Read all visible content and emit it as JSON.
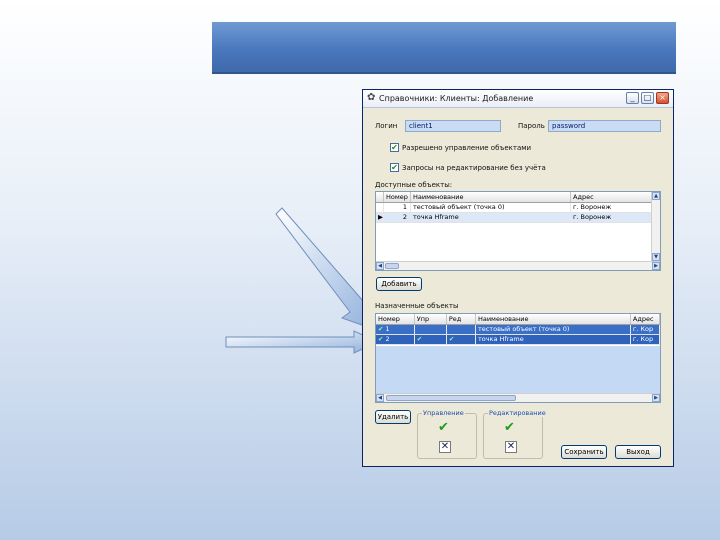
{
  "window": {
    "title": "Справочники: Клиенты: Добавление",
    "minimize": "_",
    "maximize": "□",
    "close": "×"
  },
  "login": {
    "label": "Логин",
    "value": "client1"
  },
  "password": {
    "label": "Пароль",
    "value": "password"
  },
  "options": {
    "allow_manage": "Разрешено управление объектами",
    "edit_requests": "Запросы на редактирование без учёта"
  },
  "available": {
    "title": "Доступные объекты:",
    "columns": [
      "",
      "Номер",
      "Наименование",
      "Адрес"
    ],
    "rows": [
      {
        "marker": "",
        "number": "1",
        "name": "тестовый объект (точка 0)",
        "address": "г. Воронеж"
      },
      {
        "marker": "▶",
        "number": "2",
        "name": "точка Hframe",
        "address": "г. Воронеж"
      }
    ]
  },
  "add_button": "Добавить",
  "assigned": {
    "title": "Назначенные объекты",
    "columns": [
      "Номер",
      "Упр",
      "Ред",
      "Наименование",
      "Адрес"
    ],
    "rows": [
      {
        "check": "✔",
        "number": "1",
        "manage": "",
        "edit": "",
        "name": "тестовый объект (точка 0)",
        "address": "г. Кор"
      },
      {
        "check": "✔",
        "number": "2",
        "manage": "✔",
        "edit": "✔",
        "name": "точка Hframe",
        "address": "г. Кор"
      }
    ]
  },
  "delete_button": "Удалить",
  "management_group": {
    "title": "Управление"
  },
  "editing_group": {
    "title": "Редактирование"
  },
  "save_button": "Сохранить",
  "exit_button": "Выход"
}
